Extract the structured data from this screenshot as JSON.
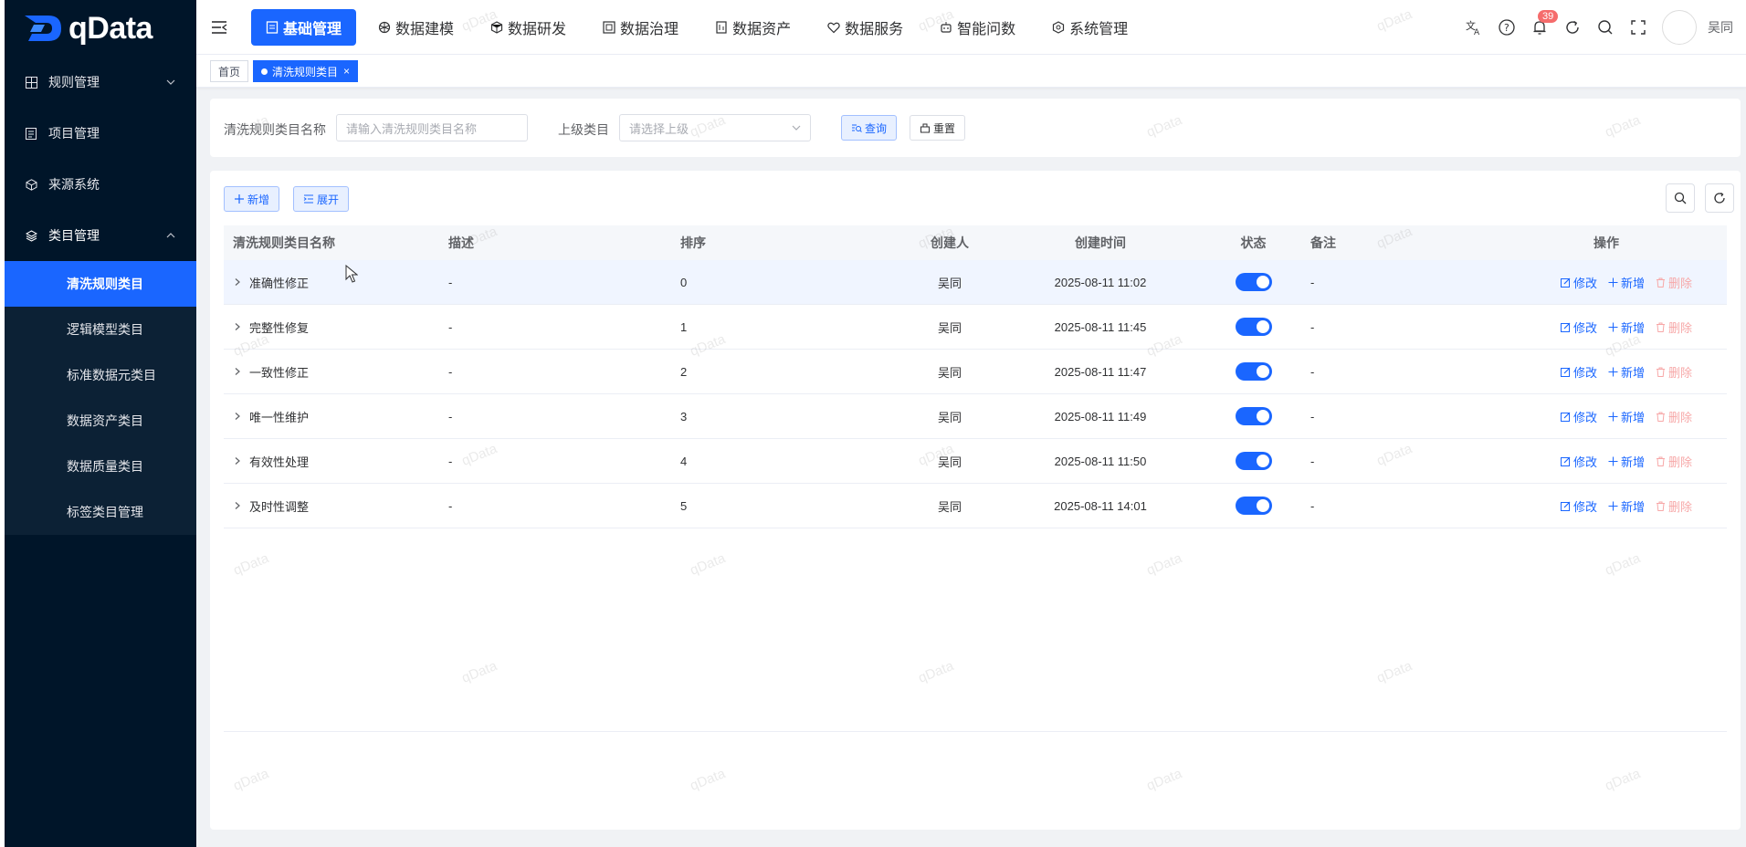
{
  "brand": {
    "logo_text": "qData"
  },
  "sidebar": {
    "items": [
      {
        "label": "规则管理",
        "icon": "grid-icon",
        "expandable": true,
        "open": false
      },
      {
        "label": "项目管理",
        "icon": "document-icon",
        "expandable": false
      },
      {
        "label": "来源系统",
        "icon": "cube-icon",
        "expandable": false
      },
      {
        "label": "类目管理",
        "icon": "layers-icon",
        "expandable": true,
        "open": true
      }
    ],
    "subitems": [
      {
        "label": "清洗规则类目",
        "active": true
      },
      {
        "label": "逻辑模型类目",
        "active": false
      },
      {
        "label": "标准数据元类目",
        "active": false
      },
      {
        "label": "数据资产类目",
        "active": false
      },
      {
        "label": "数据质量类目",
        "active": false
      },
      {
        "label": "标签类目管理",
        "active": false
      }
    ]
  },
  "header": {
    "nav": [
      {
        "label": "基础管理",
        "icon": "basic-icon",
        "active": true
      },
      {
        "label": "数据建模",
        "icon": "model-icon",
        "active": false
      },
      {
        "label": "数据研发",
        "icon": "dev-icon",
        "active": false
      },
      {
        "label": "数据治理",
        "icon": "govern-icon",
        "active": false
      },
      {
        "label": "数据资产",
        "icon": "asset-icon",
        "active": false
      },
      {
        "label": "数据服务",
        "icon": "service-icon",
        "active": false
      },
      {
        "label": "智能问数",
        "icon": "robot-icon",
        "active": false
      },
      {
        "label": "系统管理",
        "icon": "settings-icon",
        "active": false
      }
    ],
    "notification_count": "39",
    "username": "吴同"
  },
  "tabs": {
    "home": "首页",
    "current": "清洗规则类目"
  },
  "search": {
    "name_label": "清洗规则类目名称",
    "name_placeholder": "请输入清洗规则类目名称",
    "parent_label": "上级类目",
    "parent_placeholder": "请选择上级",
    "query_label": "查询",
    "reset_label": "重置"
  },
  "toolbar": {
    "add_label": "新增",
    "expand_label": "展开"
  },
  "table": {
    "columns": [
      "清洗规则类目名称",
      "描述",
      "排序",
      "创建人",
      "创建时间",
      "状态",
      "备注",
      "操作"
    ],
    "rows": [
      {
        "name": "准确性修正",
        "desc": "-",
        "sort": "0",
        "creator": "吴同",
        "time": "2025-08-11 11:02",
        "status": true,
        "note": "-"
      },
      {
        "name": "完整性修复",
        "desc": "-",
        "sort": "1",
        "creator": "吴同",
        "time": "2025-08-11 11:45",
        "status": true,
        "note": "-"
      },
      {
        "name": "一致性修正",
        "desc": "-",
        "sort": "2",
        "creator": "吴同",
        "time": "2025-08-11 11:47",
        "status": true,
        "note": "-"
      },
      {
        "name": "唯一性维护",
        "desc": "-",
        "sort": "3",
        "creator": "吴同",
        "time": "2025-08-11 11:49",
        "status": true,
        "note": "-"
      },
      {
        "name": "有效性处理",
        "desc": "-",
        "sort": "4",
        "creator": "吴同",
        "time": "2025-08-11 11:50",
        "status": true,
        "note": "-"
      },
      {
        "name": "及时性调整",
        "desc": "-",
        "sort": "5",
        "creator": "吴同",
        "time": "2025-08-11 14:01",
        "status": true,
        "note": "-"
      }
    ],
    "ops": {
      "edit": "修改",
      "add": "新增",
      "delete": "删除"
    }
  },
  "watermark": "qData",
  "colors": {
    "primary": "#1a66ff",
    "sidebar_bg": "#001529",
    "danger_light": "#f7a8a8"
  }
}
